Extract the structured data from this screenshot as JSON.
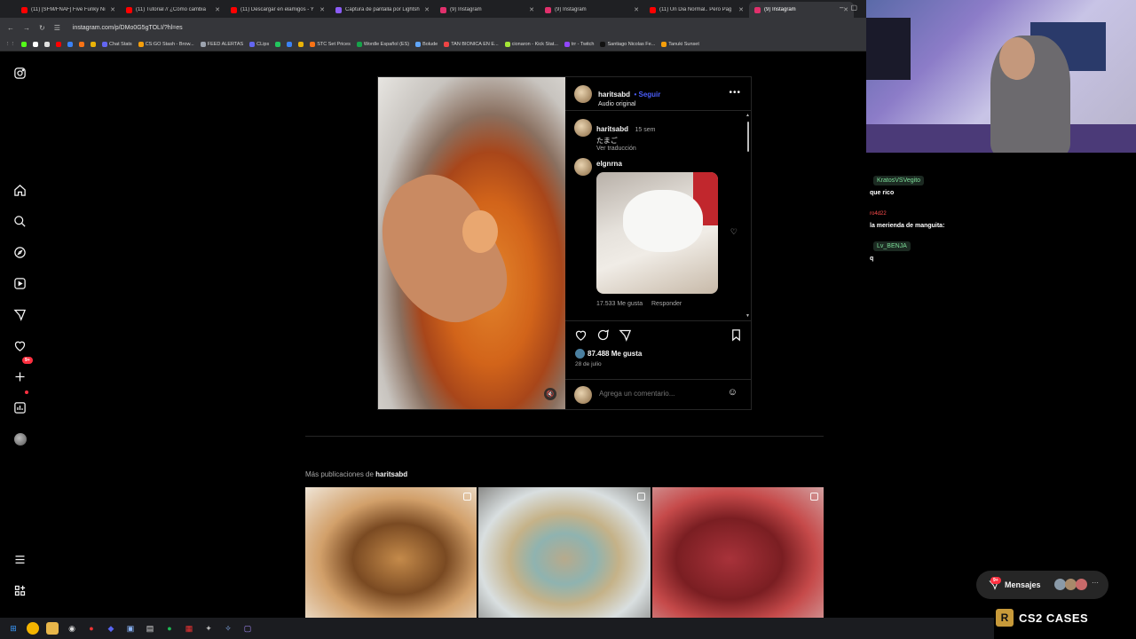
{
  "browser": {
    "tabs": [
      {
        "title": "(11) [SFM/FNAF] Five Funky Ni",
        "color": "#ff0000"
      },
      {
        "title": "(11) Tutorial // ¿Cómo cambia",
        "color": "#ff0000"
      },
      {
        "title": "(11) Descargar en elamigos - Y",
        "color": "#ff0000"
      },
      {
        "title": "Captura de pantalla por Lightsh",
        "color": "#8b5cf6"
      },
      {
        "title": "(9) Instagram",
        "color": "#e1306c"
      },
      {
        "title": "(9) Instagram",
        "color": "#e1306c"
      },
      {
        "title": "(11) Un Dia Normal.. Pero Pag",
        "color": "#ff0000"
      },
      {
        "title": "(9) Instagram",
        "color": "#e1306c"
      }
    ],
    "url": "instagram.com/p/DMo0G5gTOLI/?hl=es",
    "bookmarks": [
      "Chat Stats",
      "CS:GO Stash - Brow...",
      "FEED ALERTAS",
      "CLips",
      "STC Set Prices",
      "Wordle Español (ES)",
      "Bolude",
      "TAN BIONICA EN E...",
      "cionaron - Kick Stat...",
      "trr - Twitch",
      "Santiago Nicolas Fe...",
      "Tanuki Sunset"
    ]
  },
  "sidebar": {
    "notifications_badge": "9+"
  },
  "post": {
    "header": {
      "username": "haritsabd",
      "follow": "• Seguir",
      "audio": "Audio original"
    },
    "caption": {
      "username": "haritsabd",
      "time": "15 sem",
      "text": "たまご",
      "translate": "Ver traducción"
    },
    "comment": {
      "username": "elgnrna",
      "likes": "17.533 Me gusta",
      "reply": "Responder"
    },
    "likes": "87.488 Me gusta",
    "date": "28 de julio",
    "comment_placeholder": "Agrega un comentario..."
  },
  "more_posts": {
    "prefix": "Más publicaciones de",
    "username": "haritsabd"
  },
  "stream": {
    "chat": [
      {
        "user": "KratosVSVegito",
        "msg": "que rico"
      },
      {
        "user": "ro4d22",
        "msg": "la merienda de manguita:"
      },
      {
        "user": "Lv_BENJA",
        "msg": "q"
      }
    ],
    "messages_label": "Mensajes",
    "messages_badge": "9+",
    "sponsor": "CS2 CASES",
    "sponsor_logo": "R"
  }
}
